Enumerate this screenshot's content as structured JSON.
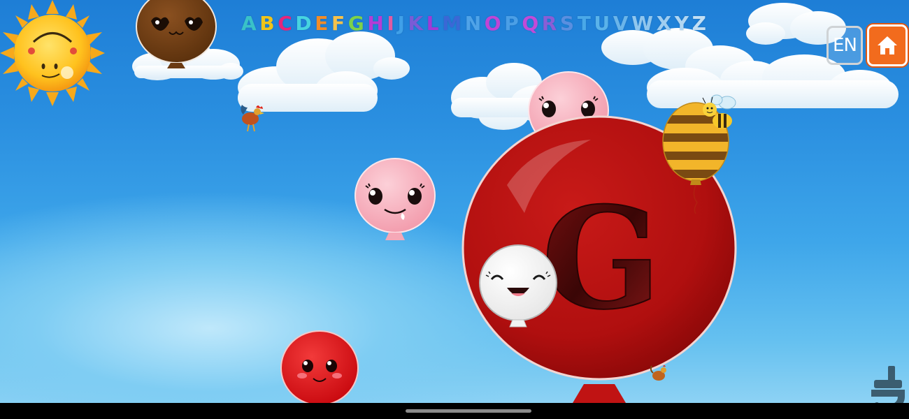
{
  "game": {
    "current_letter": "G",
    "language_button_label": "EN"
  },
  "alphabet": [
    {
      "letter": "A",
      "color": "#39c2c8"
    },
    {
      "letter": "B",
      "color": "#f0c419"
    },
    {
      "letter": "C",
      "color": "#e6257b"
    },
    {
      "letter": "D",
      "color": "#46d4e0"
    },
    {
      "letter": "E",
      "color": "#f28c28"
    },
    {
      "letter": "F",
      "color": "#f5c24c"
    },
    {
      "letter": "G",
      "color": "#7dd24a"
    },
    {
      "letter": "H",
      "color": "#b63cd6"
    },
    {
      "letter": "I",
      "color": "#e25aa2"
    },
    {
      "letter": "J",
      "color": "#3fa0e8"
    },
    {
      "letter": "K",
      "color": "#7b5bd6"
    },
    {
      "letter": "L",
      "color": "#a03ad6"
    },
    {
      "letter": "M",
      "color": "#3a68d6"
    },
    {
      "letter": "N",
      "color": "#4fa3e8"
    },
    {
      "letter": "O",
      "color": "#c045d6"
    },
    {
      "letter": "P",
      "color": "#4b9fe6"
    },
    {
      "letter": "Q",
      "color": "#c24ad8"
    },
    {
      "letter": "R",
      "color": "#8a5ed6"
    },
    {
      "letter": "S",
      "color": "#5a8fe0"
    },
    {
      "letter": "T",
      "color": "#4aa8e8"
    },
    {
      "letter": "U",
      "color": "#5ab3ea"
    },
    {
      "letter": "V",
      "color": "#6ab5ea"
    },
    {
      "letter": "W",
      "color": "#8fc6ee"
    },
    {
      "letter": "X",
      "color": "#9fcdf0"
    },
    {
      "letter": "Y",
      "color": "#b0d6f2"
    },
    {
      "letter": "Z",
      "color": "#c2dff4"
    }
  ],
  "colors": {
    "big_balloon": "#b50f0f",
    "pink_balloon": "#f7b3c0",
    "brown_balloon": "#6b3a12",
    "red_balloon": "#e0141a",
    "white_balloon": "#ffffff",
    "home_button": "#f26b1d"
  },
  "icons": [
    "sun-face-icon",
    "rooster-icon",
    "bee-icon",
    "home-icon",
    "store-logo-icon"
  ]
}
